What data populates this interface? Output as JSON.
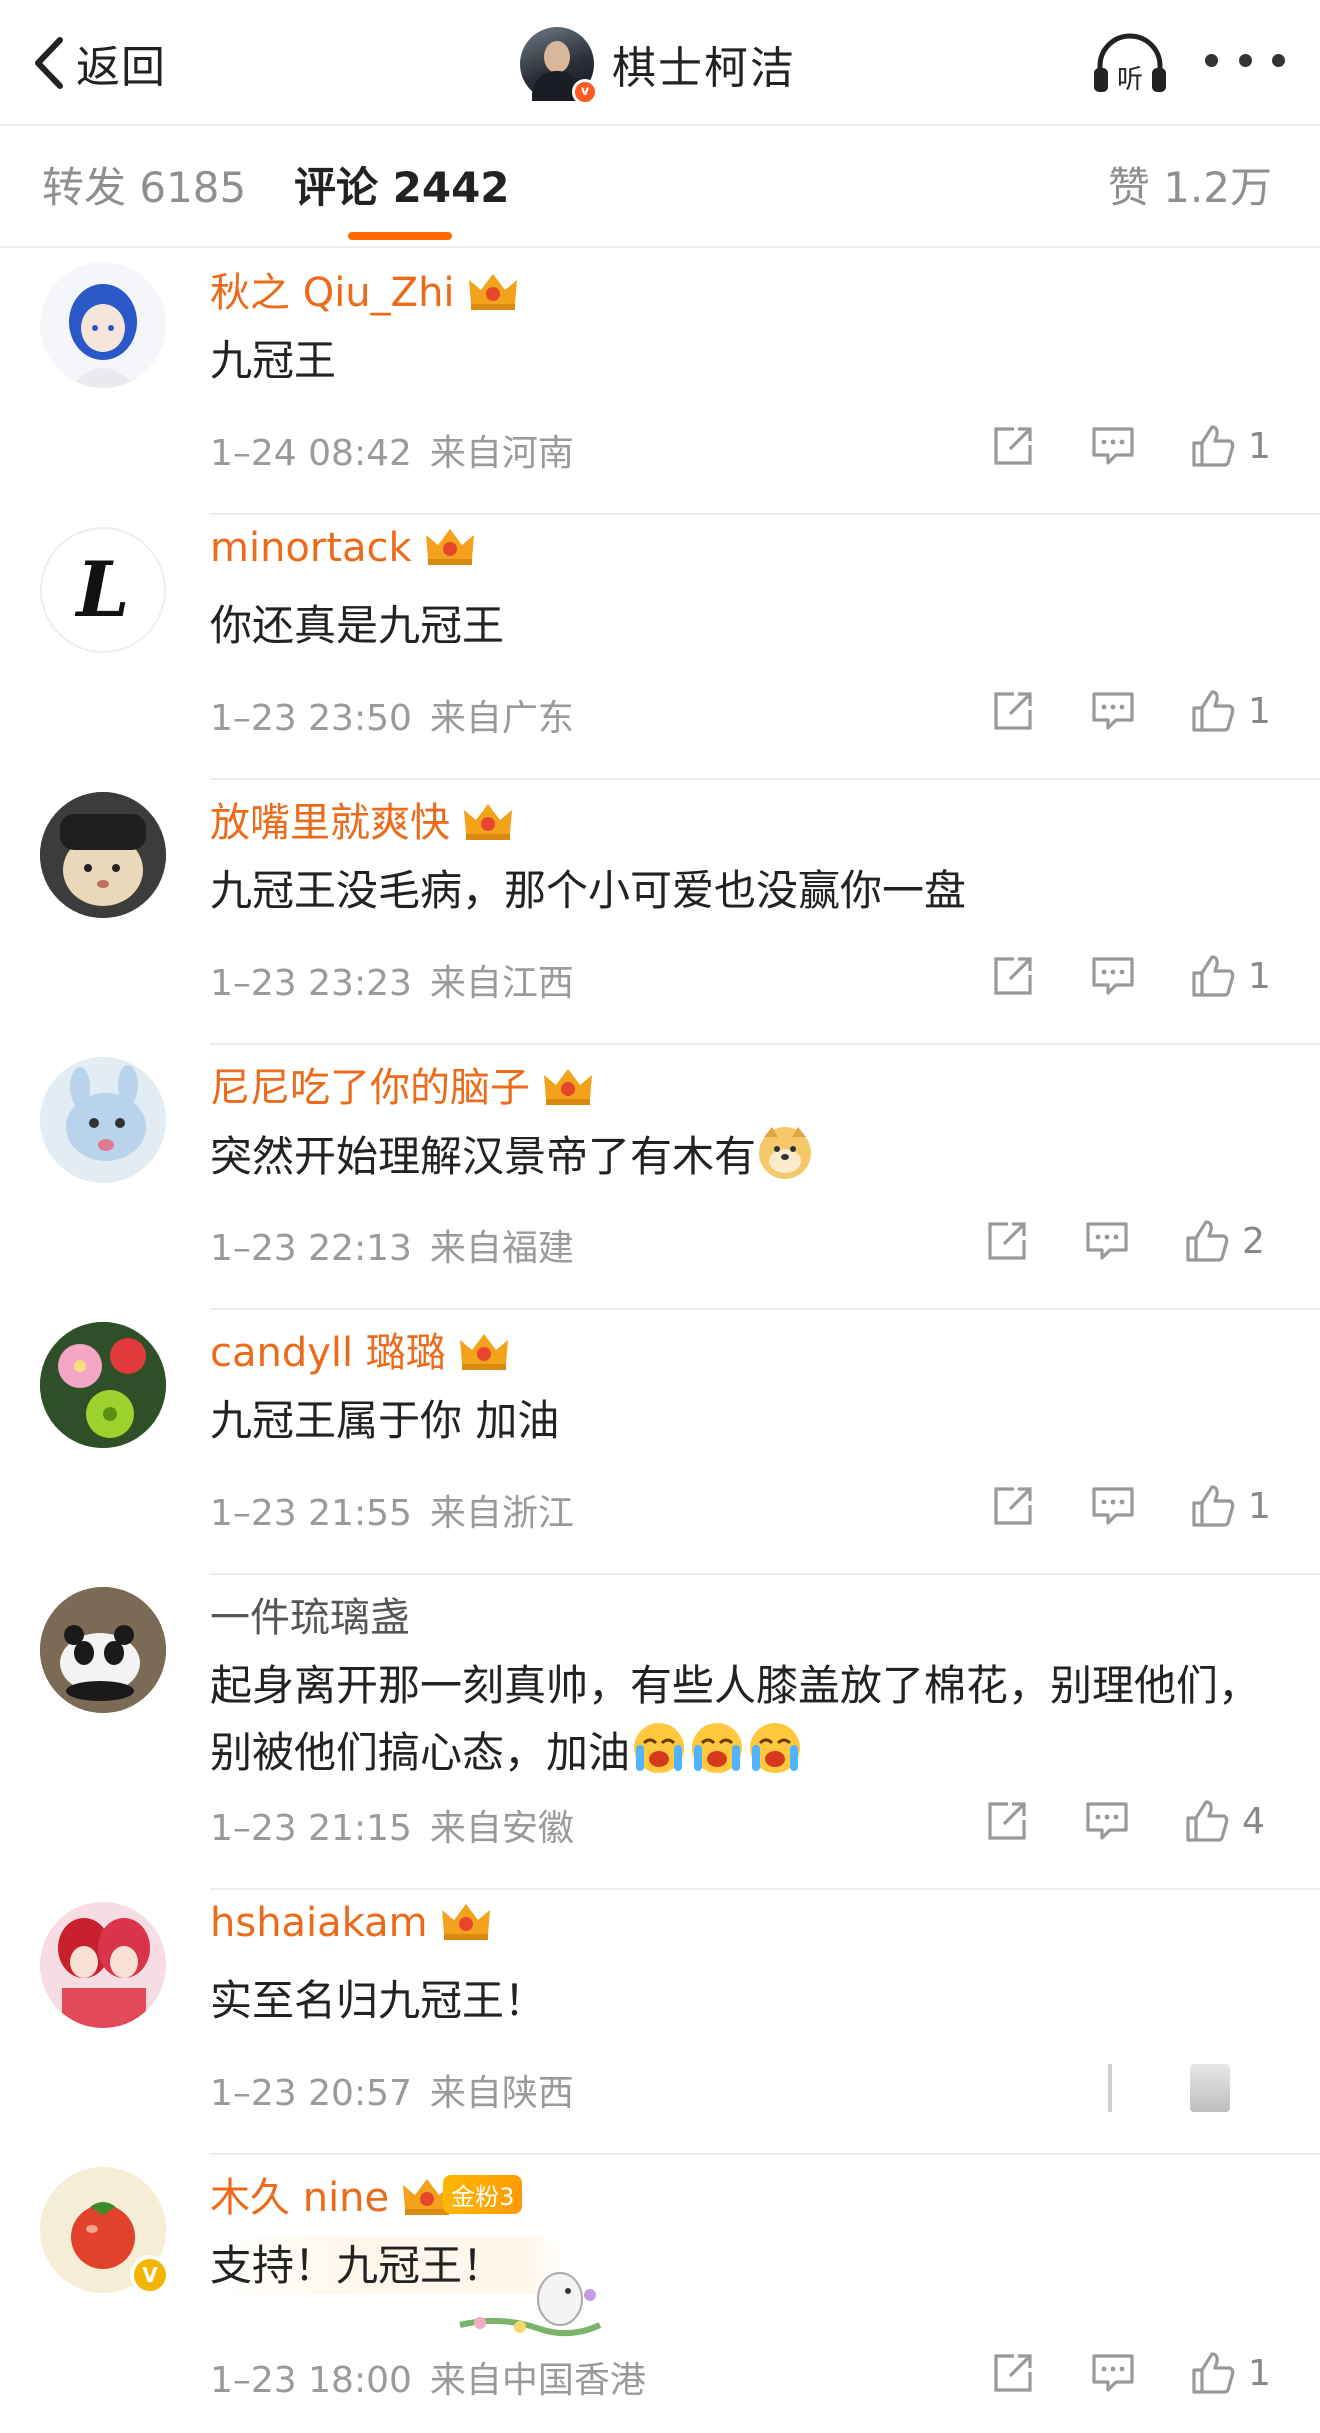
{
  "nav": {
    "back_label": "返回",
    "profile_name": "棋士柯洁",
    "listen_label": "听"
  },
  "tabs": {
    "repost": "转发 6185",
    "comments": "评论 2442",
    "likes": "赞 1.2万"
  },
  "colors": {
    "username": "#eb6b1b",
    "accent": "#ff6a00",
    "meta": "#9a9a9a"
  },
  "comments": [
    {
      "user": "秋之 Qiu_Zhi",
      "text": "九冠王",
      "time": "1–24 08:42",
      "location": "来自河南",
      "likes": "1"
    },
    {
      "user": "minortack",
      "text": "你还真是九冠王",
      "time": "1–23 23:50",
      "location": "来自广东",
      "likes": "1"
    },
    {
      "user": "放嘴里就爽快",
      "text": "九冠王没毛病，那个小可爱也没赢你一盘",
      "time": "1–23 23:23",
      "location": "来自江西",
      "likes": "1"
    },
    {
      "user": "尼尼吃了你的脑子",
      "text": "突然开始理解汉景帝了有木有",
      "time": "1–23 22:13",
      "location": "来自福建",
      "likes": "2"
    },
    {
      "user": "candyll 璐璐",
      "text": "九冠王属于你 加油",
      "time": "1–23 21:55",
      "location": "来自浙江",
      "likes": "1"
    },
    {
      "user": "一件琉璃盏",
      "text": "起身离开那一刻真帅，有些人膝盖放了棉花，别理他们，别被他们搞心态，加油",
      "time": "1–23 21:15",
      "location": "来自安徽",
      "likes": "4"
    },
    {
      "user": "hshaiakam",
      "text": "实至名归九冠王！",
      "time": "1–23 20:57",
      "location": "来自陕西",
      "likes": ""
    },
    {
      "user": "木久 nine",
      "fan_badge": "金粉3",
      "text": "支持！九冠王！",
      "time": "1–23 18:00",
      "location": "来自中国香港",
      "likes": "1"
    }
  ],
  "icons": [
    "back-chevron-icon",
    "listen-headphones-icon",
    "more-dots-icon",
    "crown-icon",
    "share-icon",
    "comment-icon",
    "like-icon",
    "verified-icon"
  ]
}
